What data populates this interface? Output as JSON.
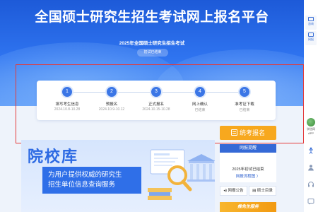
{
  "hero": {
    "title": "全国硕士研究生招生考试网上报名平台",
    "subtitle": "2025年全国硕士研究生招生考试",
    "status_pill": "初试已结束"
  },
  "steps": [
    {
      "num": "1",
      "name": "填写考生信息",
      "date": "2024.10.8-10.28"
    },
    {
      "num": "2",
      "name": "预报名",
      "date": "2024.10.9-10.12"
    },
    {
      "num": "3",
      "name": "正式报名",
      "date": "2024.10.15-10.28"
    },
    {
      "num": "4",
      "name": "网上确认",
      "date": "已结束"
    },
    {
      "num": "5",
      "name": "准考证下载",
      "date": "已结束"
    }
  ],
  "actions": {
    "exam_register": "统考报名"
  },
  "banner": {
    "heading": "院校库",
    "desc_line1": "为用户提供权威的研究生",
    "desc_line2": "招生单位信息查询服务"
  },
  "notice": {
    "header": "网报提醒",
    "item1": "2025年初试已结束",
    "item2": "网报流程图 〉",
    "btn_announcement": "网报公告",
    "btn_catalog": "硕士目录",
    "bottom": "推免生服务"
  },
  "sidebar": {
    "tile1": "咨询",
    "tile2": "网报",
    "app_line1": "学信网",
    "app_line2": "APP"
  },
  "colors": {
    "primary": "#2f74f0",
    "accent": "#f7a81e",
    "frame": "#e43a3a"
  }
}
